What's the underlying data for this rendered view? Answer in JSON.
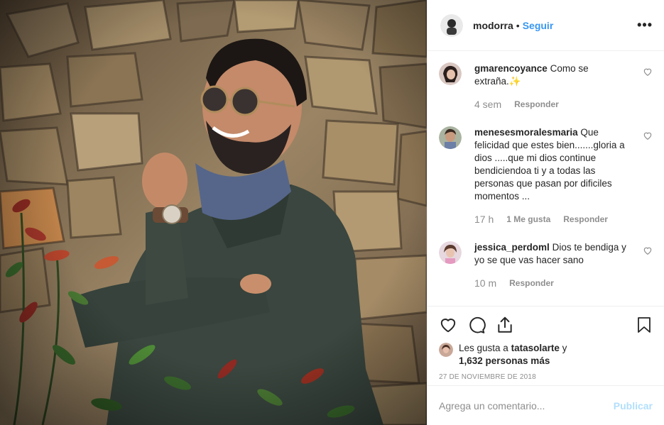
{
  "post": {
    "author": "modorra",
    "separator": "•",
    "follow_label": "Seguir",
    "more_label": "•••",
    "photo": {
      "alt": "",
      "colors": {
        "wall": "#8a7456",
        "jacket": "#3f4a42",
        "shirt": "#5a6a88",
        "plant_red": "#8e2a22",
        "plant_green": "#3a6a2c"
      }
    }
  },
  "comments": [
    {
      "username": "gmarencoyance",
      "text": "Como se extraña.",
      "emoji": "✨",
      "time": "4 sem",
      "likes": "",
      "reply_label": "Responder",
      "avatar_color": "#d9c7c2"
    },
    {
      "username": "menesesmoralesmaria",
      "text": "Que felicidad que estes bien.......gloria a dios .....que mi dios continue bendiciendoa ti y a todas las personas que pasan por dificiles momentos ...",
      "emoji": "",
      "time": "17 h",
      "likes": "1 Me gusta",
      "reply_label": "Responder",
      "avatar_color": "#a9b3a0"
    },
    {
      "username": "jessica_perdoml",
      "text": "Dios te bendiga y yo se que vas hacer sano",
      "emoji": "",
      "time": "10 m",
      "likes": "",
      "reply_label": "Responder",
      "avatar_color": "#e7d7de"
    }
  ],
  "actions": {
    "icons": [
      "heart-icon",
      "comment-icon",
      "share-icon",
      "bookmark-icon"
    ],
    "likes_prefix": "Les gusta a",
    "likes_user": "tatasolarte",
    "likes_and": "y",
    "likes_count": "1,632 personas más",
    "date": "27 DE NOVIEMBRE DE 2018"
  },
  "add_comment": {
    "placeholder": "Agrega un comentario...",
    "publish_label": "Publicar"
  },
  "colors": {
    "link": "#3897f0",
    "muted": "#8e8e8e",
    "publish_disabled": "#b2dffc"
  }
}
